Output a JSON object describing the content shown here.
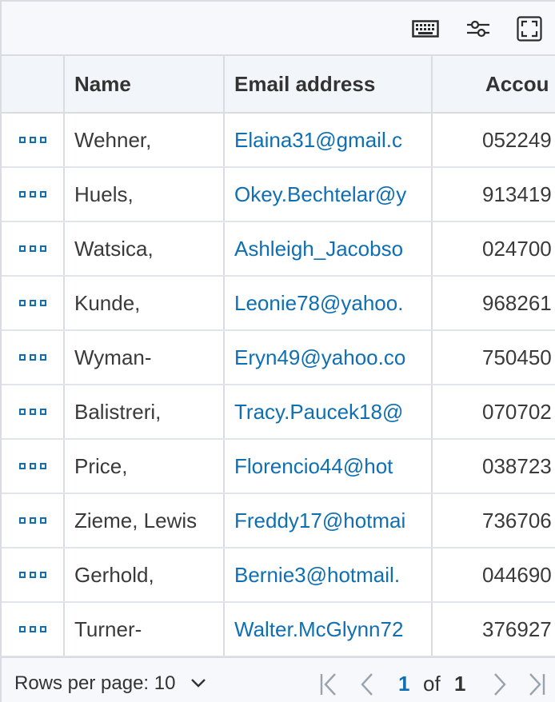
{
  "toolbar": {
    "icons": [
      "keyboard-icon",
      "sliders-icon",
      "fullscreen-icon"
    ]
  },
  "table": {
    "columns": [
      "",
      "Name",
      "Email address",
      "Accou"
    ],
    "rows": [
      {
        "name": "Wehner,",
        "email": "Elaina31@gmail.c",
        "account": "052249"
      },
      {
        "name": "Huels,",
        "email": "Okey.Bechtelar@y",
        "account": "913419"
      },
      {
        "name": "Watsica,",
        "email": "Ashleigh_Jacobso",
        "account": "024700"
      },
      {
        "name": "Kunde,",
        "email": "Leonie78@yahoo.",
        "account": "968261"
      },
      {
        "name": "Wyman-",
        "email": "Eryn49@yahoo.co",
        "account": "750450"
      },
      {
        "name": "Balistreri,",
        "email": "Tracy.Paucek18@",
        "account": "070702"
      },
      {
        "name": "Price,",
        "email": "Florencio44@hot",
        "account": "038723"
      },
      {
        "name": "Zieme, Lewis",
        "email": "Freddy17@hotmai",
        "account": "736706"
      },
      {
        "name": "Gerhold,",
        "email": "Bernie3@hotmail.",
        "account": "044690"
      },
      {
        "name": "Turner-",
        "email": "Walter.McGlynn72",
        "account": "376927"
      }
    ]
  },
  "footer": {
    "rows_per_page_label": "Rows per page: 10",
    "current_page": "1",
    "of_label": "of",
    "total_pages": "1"
  },
  "colors": {
    "accent": "#0f6fb2",
    "border": "#d9dde3",
    "header_bg": "#f2f5f9"
  }
}
